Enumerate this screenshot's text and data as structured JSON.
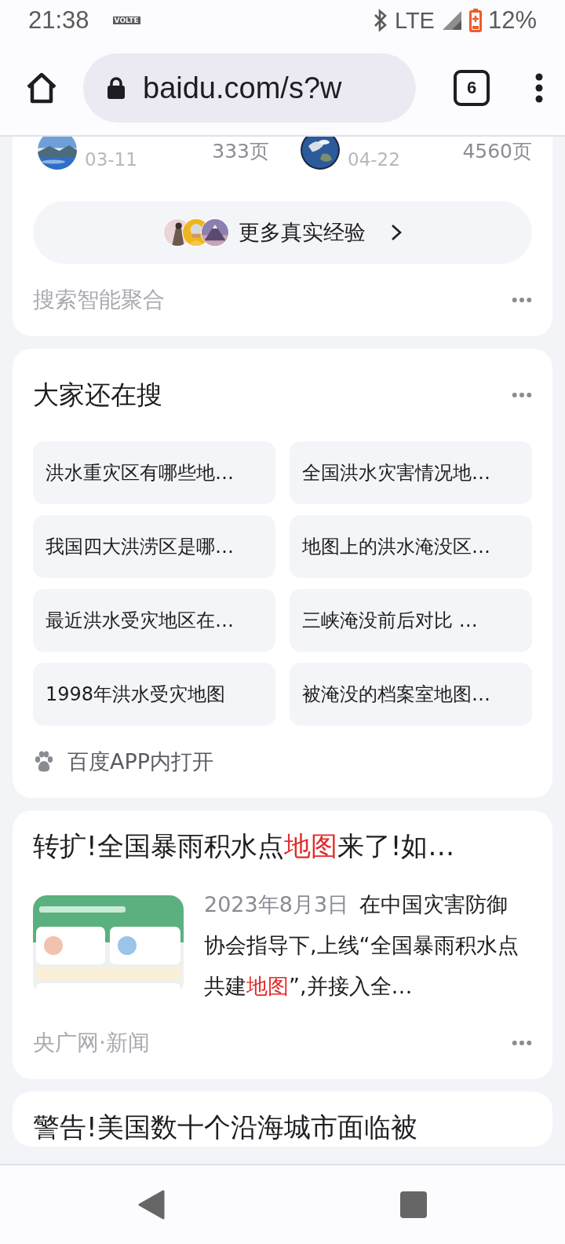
{
  "status_bar": {
    "time": "21:38",
    "volte": "VOLTE",
    "network": "LTE",
    "battery": "12%"
  },
  "toolbar": {
    "url": "baidu.com/s?w",
    "tab_count": "6"
  },
  "experience_card": {
    "items": [
      {
        "date": "03-11",
        "pages": "333页"
      },
      {
        "date": "04-22",
        "pages": "4560页"
      }
    ],
    "more_button": "更多真实经验",
    "source": "搜索智能聚合"
  },
  "related_searches": {
    "title": "大家还在搜",
    "items": [
      "洪水重灾区有哪些地…",
      "全国洪水灾害情况地…",
      "我国四大洪涝区是哪…",
      "地图上的洪水淹没区…",
      "最近洪水受灾地区在…",
      "三峡淹没前后对比 …",
      "1998年洪水受灾地图",
      "被淹没的档案室地图…"
    ],
    "open_in_app": "百度APP内打开"
  },
  "results": [
    {
      "title_parts": [
        {
          "text": "转扩!全国暴雨积水点",
          "highlight": false
        },
        {
          "text": "地图",
          "highlight": true
        },
        {
          "text": "来了!如…",
          "highlight": false
        }
      ],
      "date": "2023年8月3日",
      "snippet_parts": [
        {
          "text": "在中国灾害防御协会指导下,上线“全国暴雨积水点共建",
          "highlight": false
        },
        {
          "text": "地图",
          "highlight": true
        },
        {
          "text": "”,并接入全…",
          "highlight": false
        }
      ],
      "source": "央广网·新闻"
    },
    {
      "title_parts": [
        {
          "text": "警告!美国数十个沿海城市面临被",
          "highlight": false
        }
      ]
    }
  ]
}
